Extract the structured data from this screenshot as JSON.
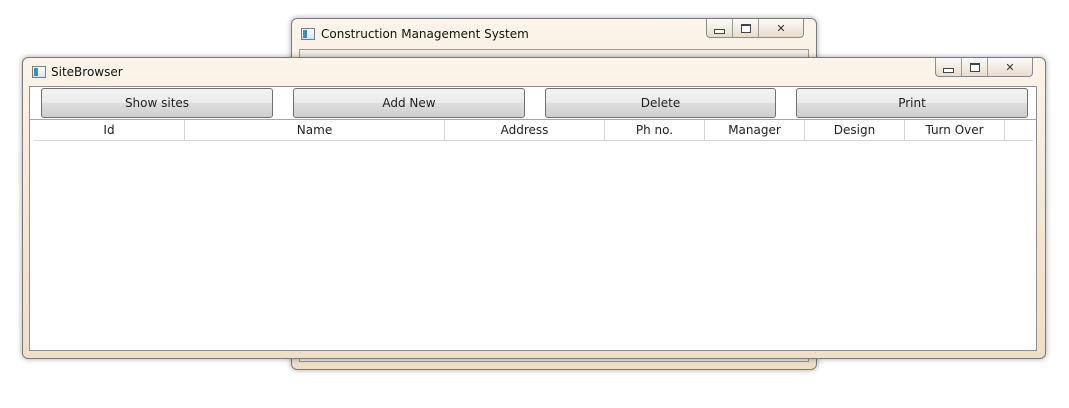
{
  "back_window": {
    "title": "Construction Management System",
    "controls": {
      "close": "✕"
    }
  },
  "site_browser": {
    "title": "SiteBrowser",
    "controls": {
      "close": "✕"
    },
    "buttons": {
      "show_sites": "Show sites",
      "add_new": "Add New",
      "delete": "Delete",
      "print": "Print"
    },
    "columns": [
      "Id",
      "Name",
      "Address",
      "Ph no.",
      "Manager",
      "Design",
      "Turn Over"
    ],
    "rows": []
  }
}
